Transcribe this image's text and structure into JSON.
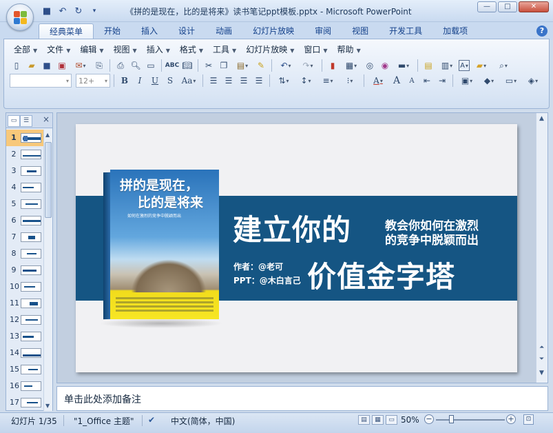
{
  "window": {
    "title": "《拼的是现在，比的是将来》读书笔记ppt模板.pptx - Microsoft PowerPoint",
    "buttons": {
      "minimize": "—",
      "maximize": "□",
      "close": "✕"
    }
  },
  "quick_access": {
    "save_icon": "💾",
    "undo_icon": "↶",
    "redo_icon": "↻",
    "customize_icon": "▾"
  },
  "tabs": [
    "经典菜单",
    "开始",
    "插入",
    "设计",
    "动画",
    "幻灯片放映",
    "审阅",
    "视图",
    "开发工具",
    "加载项"
  ],
  "help_label": "?",
  "menus": [
    "全部",
    "文件",
    "编辑",
    "视图",
    "插入",
    "格式",
    "工具",
    "幻灯片放映",
    "窗口",
    "帮助"
  ],
  "toolbar": {
    "font_name": "",
    "font_size": "12+",
    "bold": "B",
    "italic": "I",
    "underline": "U",
    "shadow": "S",
    "case": "Aa",
    "font_color": "A",
    "grow": "A",
    "shrink": "A"
  },
  "left_pane": {
    "close": "×",
    "selected": 1,
    "slides": [
      "1",
      "2",
      "3",
      "4",
      "5",
      "6",
      "7",
      "8",
      "9",
      "10",
      "11",
      "12",
      "13",
      "14",
      "15",
      "16",
      "17"
    ]
  },
  "slide": {
    "book_title_line1": "拼的是现在，",
    "book_title_line2": "比的是将来",
    "book_subtitle": "如何在激烈的竞争中脱颖而出",
    "headline_line1": "建立你的",
    "headline_line2": "价值金字塔",
    "subtext_line1": "教会你如何在激烈",
    "subtext_line2": "的竞争中脱颖而出",
    "author": "作者：@老可",
    "ppt_credit": "PPT：@木白言己"
  },
  "notes_placeholder": "单击此处添加备注",
  "status": {
    "slide_info": "幻灯片 1/35",
    "theme": "\"1_Office 主题\"",
    "language": "中文(简体，中国)",
    "zoom": "50%",
    "zoom_minus": "−",
    "zoom_plus": "+"
  }
}
